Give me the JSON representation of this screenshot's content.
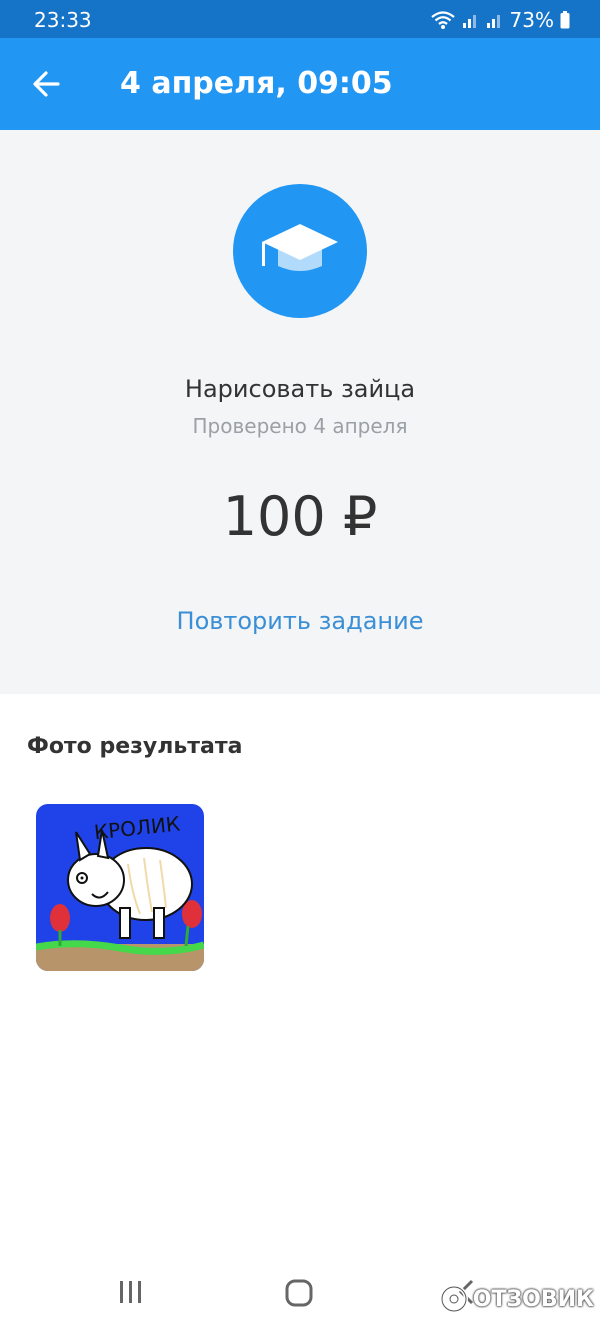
{
  "status_bar": {
    "time": "23:33",
    "battery": "73%"
  },
  "app_bar": {
    "title": "4 апреля, 09:05"
  },
  "task": {
    "title": "Нарисовать зайца",
    "status": "Проверено 4 апреля",
    "amount": "100 ₽",
    "repeat_label": "Повторить задание"
  },
  "result": {
    "section_title": "Фото результата",
    "drawing_text": "КРОЛИК"
  },
  "watermark": {
    "text": "ОТЗОВИК"
  },
  "colors": {
    "accent": "#2296f3",
    "status_bar": "#1674c8",
    "link": "#3a8fd6",
    "hero_bg": "#f4f5f7"
  },
  "icons": {
    "back": "arrow-left-icon",
    "task": "graduation-cap-icon",
    "nav_recent": "recent-apps-icon",
    "nav_home": "home-icon",
    "nav_back": "back-icon"
  }
}
